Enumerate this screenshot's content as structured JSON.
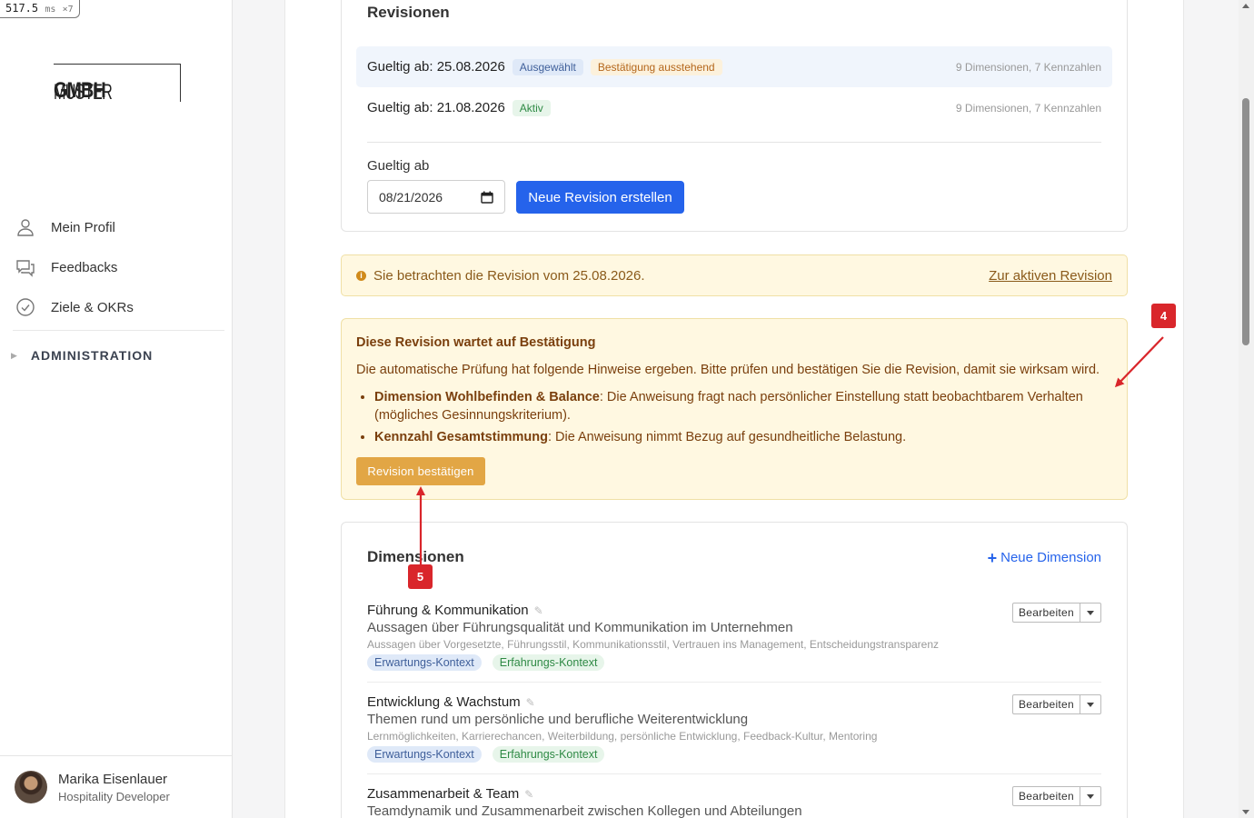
{
  "perf": {
    "time": "517.5",
    "unit": "ms",
    "mult": "×7"
  },
  "logo": {
    "part1": "MUSTER",
    "part2": "GMBH"
  },
  "nav": [
    {
      "label": "Mein Profil",
      "icon": "user-icon"
    },
    {
      "label": "Feedbacks",
      "icon": "chat-icon"
    },
    {
      "label": "Ziele & OKRs",
      "icon": "check-circle-icon"
    }
  ],
  "admin_label": "ADMINISTRATION",
  "user": {
    "name": "Marika Eisenlauer",
    "role": "Hospitality Developer"
  },
  "revisions": {
    "title": "Revisionen",
    "rows": [
      {
        "label": "Gueltig ab: 25.08.2026",
        "tags": [
          "Ausgewählt",
          "Bestätigung ausstehend"
        ],
        "meta": "9 Dimensionen, 7 Kennzahlen"
      },
      {
        "label": "Gueltig ab: 21.08.2026",
        "tags": [
          "Aktiv"
        ],
        "meta": "9 Dimensionen, 7 Kennzahlen"
      }
    ],
    "field_label": "Gueltig ab",
    "date_value": "08/21/2026",
    "create_button": "Neue Revision erstellen"
  },
  "notice": {
    "text": "Sie betrachten die Revision vom 25.08.2026.",
    "link": "Zur aktiven Revision"
  },
  "warning": {
    "title": "Diese Revision wartet auf Bestätigung",
    "text": "Die automatische Prüfung hat folgende Hinweise ergeben. Bitte prüfen und bestätigen Sie die Revision, damit sie wirksam wird.",
    "items": [
      {
        "bold": "Dimension Wohlbefinden & Balance",
        "rest": ": Die Anweisung fragt nach persönlicher Einstellung statt beobachtbarem Verhalten (mögliches Gesinnungskriterium)."
      },
      {
        "bold": "Kennzahl Gesamtstimmung",
        "rest": ": Die Anweisung nimmt Bezug auf gesundheitliche Belastung."
      }
    ],
    "confirm_button": "Revision bestätigen"
  },
  "dimensions": {
    "title": "Dimensionen",
    "new_button": "Neue Dimension",
    "edit_label": "Bearbeiten",
    "items": [
      {
        "name": "Führung & Kommunikation",
        "desc": "Aussagen über Führungsqualität und Kommunikation im Unternehmen",
        "keywords": "Aussagen über Vorgesetzte, Führungsstil, Kommunikationsstil, Vertrauen ins Management, Entscheidungstransparenz",
        "tags": [
          "Erwartungs-Kontext",
          "Erfahrungs-Kontext"
        ]
      },
      {
        "name": "Entwicklung & Wachstum",
        "desc": "Themen rund um persönliche und berufliche Weiterentwicklung",
        "keywords": "Lernmöglichkeiten, Karrierechancen, Weiterbildung, persönliche Entwicklung, Feedback-Kultur, Mentoring",
        "tags": [
          "Erwartungs-Kontext",
          "Erfahrungs-Kontext"
        ]
      },
      {
        "name": "Zusammenarbeit & Team",
        "desc": "Teamdynamik und Zusammenarbeit zwischen Kollegen und Abteilungen",
        "keywords": "",
        "tags": []
      }
    ]
  },
  "annotations": [
    {
      "label": "4"
    },
    {
      "label": "5"
    }
  ],
  "colors": {
    "primary": "#2563eb",
    "warning_bg": "#fff8e1",
    "warning_button": "#e2a645",
    "annotation": "#d9262b"
  }
}
